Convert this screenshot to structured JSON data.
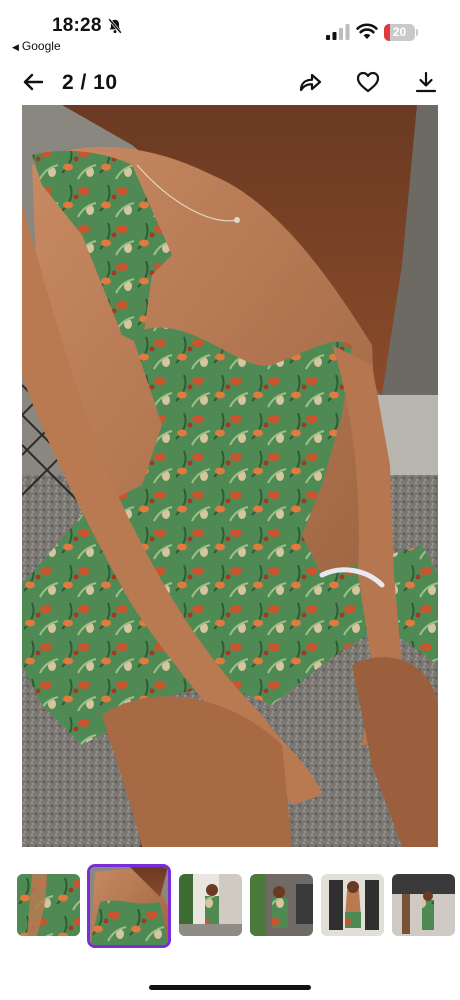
{
  "status_bar": {
    "time": "18:28",
    "back_app_label": "Google",
    "battery_level": "20",
    "battery_color": "#e03b3b",
    "icons": [
      "bell-slash-icon",
      "signal-icon",
      "wifi-icon",
      "battery-icon"
    ]
  },
  "toolbar": {
    "counter": "2 / 10",
    "icons": [
      "arrow-left-icon",
      "share-icon",
      "heart-icon",
      "download-icon"
    ]
  },
  "gallery": {
    "current_index": 2,
    "total": 10,
    "active_color": "#7b2bd8",
    "thumbnail_count": 6
  }
}
